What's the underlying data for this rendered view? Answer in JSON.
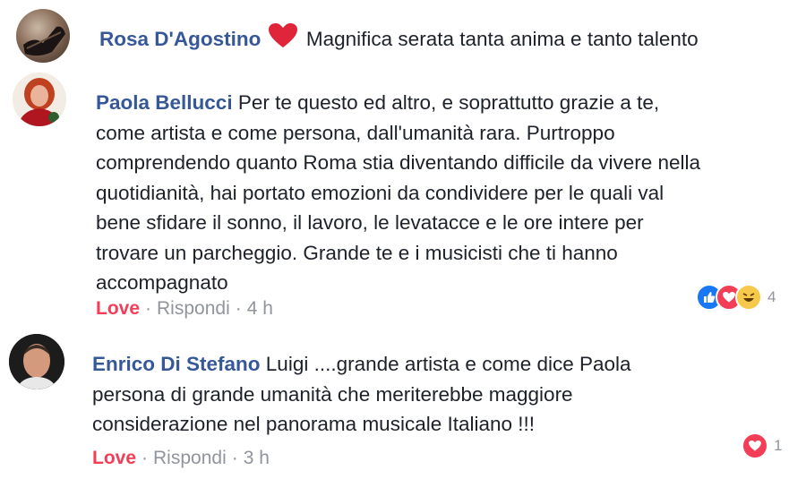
{
  "comments": [
    {
      "author": "Rosa D'Agostino",
      "text": "Magnifica serata  tanta anima e tanto talento"
    },
    {
      "author": "Paola Bellucci",
      "text_lines": [
        "Per te questo ed altro, e soprattutto grazie a te,",
        "come artista e come persona, dall'umanità rara. Purtroppo",
        "comprendendo quanto Roma stia diventando difficile da vivere nella",
        "quotidianità, hai portato emozioni da condividere per le quali val",
        "bene sfidare il sonno, il lavoro, le levatacce e le ore intere per",
        "trovare un parcheggio. Grande te e i musicisti che ti hanno",
        "accompagnato"
      ],
      "love_label": "Love",
      "reply_label": "Rispondi",
      "time": "4 h",
      "reaction_count": "4"
    },
    {
      "author": "Enrico Di Stefano",
      "text_lines": [
        "Luigi ....grande artista e come dice Paola",
        "persona di grande umanità che meriterebbe maggiore",
        "considerazione nel panorama musicale Italiano !!!"
      ],
      "love_label": "Love",
      "reply_label": "Rispondi",
      "time": "3 h",
      "reaction_count": "1"
    }
  ],
  "separator": "·",
  "colors": {
    "author": "#365899",
    "love": "#f33e58",
    "meta": "#90949c",
    "like_blue": "#1877f2",
    "haha_yellow": "#f7c94b"
  }
}
